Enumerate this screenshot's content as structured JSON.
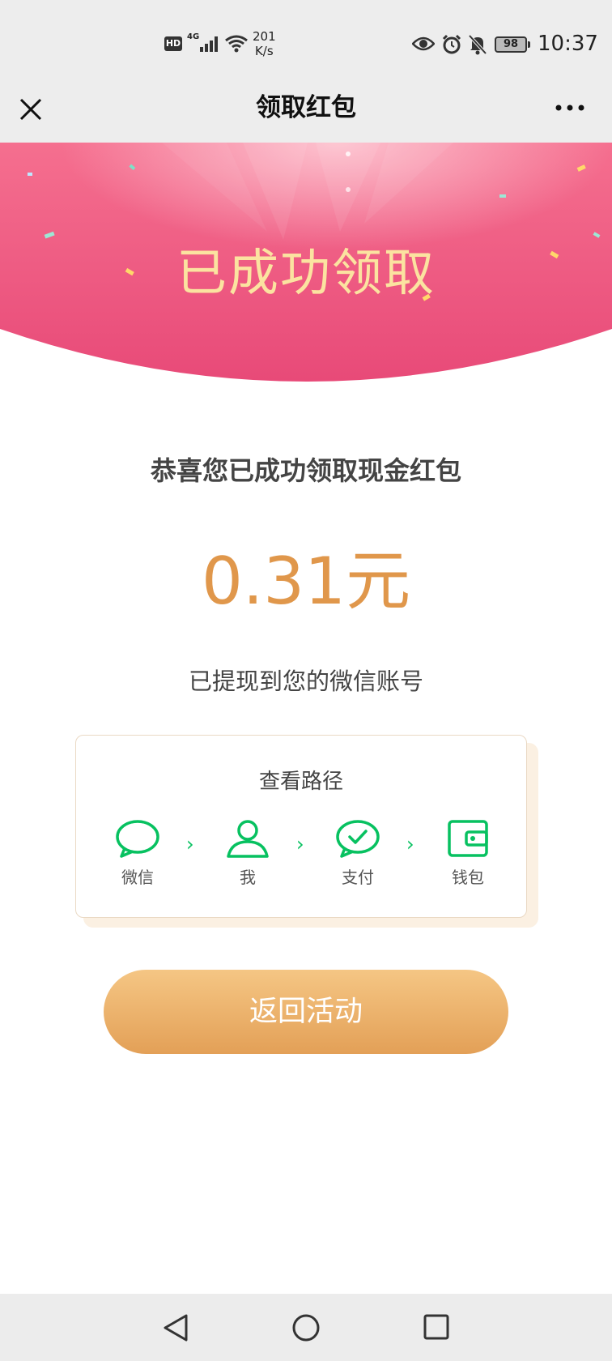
{
  "status_bar": {
    "hd": "HD",
    "network": "4G",
    "speed_value": "201",
    "speed_unit": "K/s",
    "battery": "98",
    "time": "10:37"
  },
  "nav": {
    "title": "领取红包"
  },
  "banner": {
    "title": "已成功领取",
    "colors": {
      "top": "#f56f8f",
      "bottom": "#e84a78",
      "title": "#fbe3a0"
    }
  },
  "main": {
    "congrats": "恭喜您已成功领取现金红包",
    "amount": "0.31元",
    "note": "已提现到您的微信账号"
  },
  "path_card": {
    "title": "查看路径",
    "steps": [
      {
        "label": "微信",
        "icon": "chat-bubble-icon"
      },
      {
        "label": "我",
        "icon": "user-icon"
      },
      {
        "label": "支付",
        "icon": "check-bubble-icon"
      },
      {
        "label": "钱包",
        "icon": "wallet-icon"
      }
    ],
    "accent": "#07c160"
  },
  "back_button": {
    "label": "返回活动"
  }
}
